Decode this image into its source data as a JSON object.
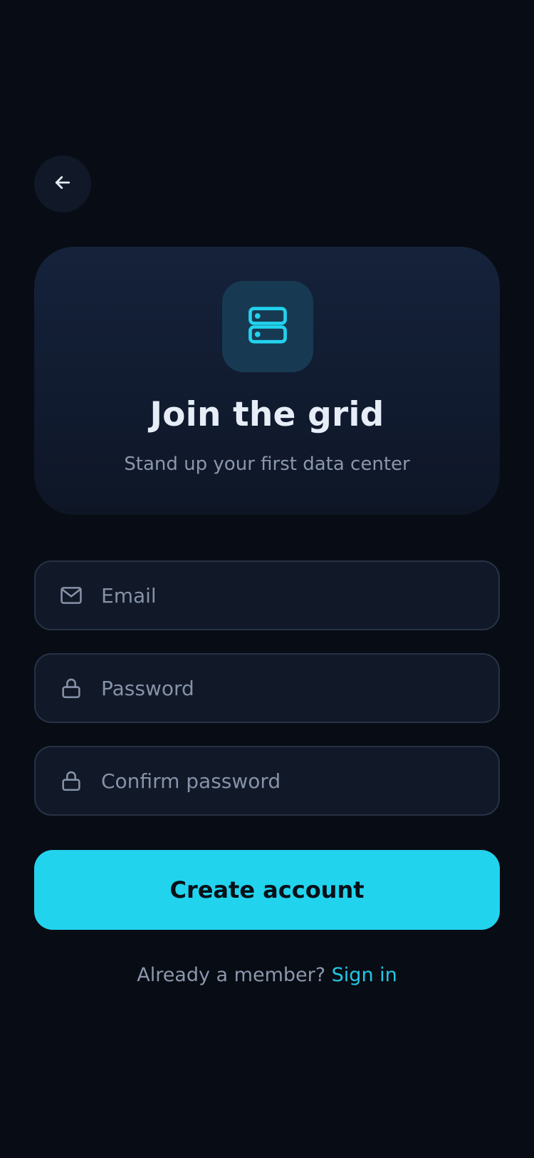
{
  "header": {
    "back_icon": "arrow-left-icon"
  },
  "hero": {
    "icon": "server-icon",
    "title": "Join the grid",
    "subtitle": "Stand up your first data center"
  },
  "form": {
    "email": {
      "icon": "mail-icon",
      "placeholder": "Email",
      "value": ""
    },
    "password": {
      "icon": "lock-icon",
      "placeholder": "Password",
      "value": ""
    },
    "confirm_password": {
      "icon": "lock-icon",
      "placeholder": "Confirm password",
      "value": ""
    },
    "submit_label": "Create account"
  },
  "footer": {
    "prompt": "Already a member?",
    "link_label": "Sign in"
  },
  "colors": {
    "background": "#080c14",
    "accent": "#22d3ee",
    "field_bg": "#111827",
    "muted_text": "#8b97ab"
  }
}
